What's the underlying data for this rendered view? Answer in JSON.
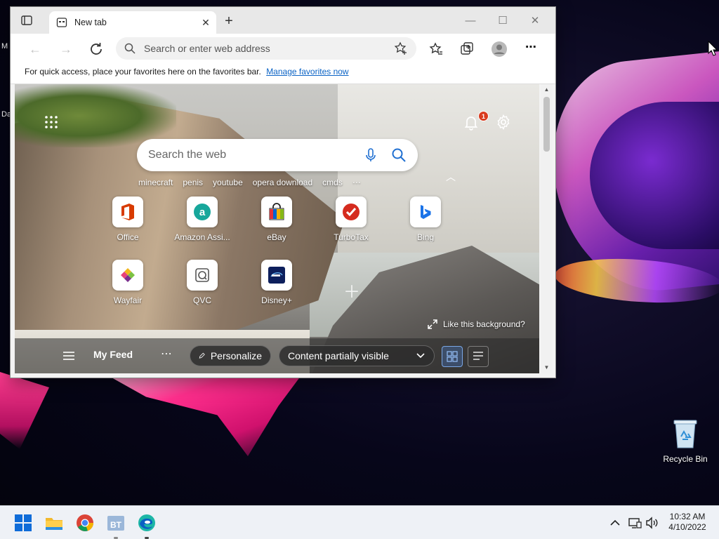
{
  "desktop": {
    "left_letters": [
      "M",
      "Da"
    ],
    "recycle_bin_label": "Recycle Bin"
  },
  "browser": {
    "tab_title": "New tab",
    "address_placeholder": "Search or enter web address",
    "favorites_bar": {
      "message": "For quick access, place your favorites here on the favorites bar.",
      "link": "Manage favorites now"
    },
    "ntp": {
      "search_placeholder": "Search the web",
      "notification_count": "1",
      "trending": [
        "minecraft",
        "penis",
        "youtube",
        "opera download",
        "cmds",
        "⋯"
      ],
      "tiles": [
        {
          "name": "Office",
          "icon": "office-icon"
        },
        {
          "name": "Amazon Assi...",
          "icon": "amazon-assistant-icon"
        },
        {
          "name": "eBay",
          "icon": "ebay-icon"
        },
        {
          "name": "TurboTax",
          "icon": "turbotax-icon"
        },
        {
          "name": "Bing",
          "icon": "bing-icon"
        },
        {
          "name": "Wayfair",
          "icon": "wayfair-icon"
        },
        {
          "name": "QVC",
          "icon": "qvc-icon"
        },
        {
          "name": "Disney+",
          "icon": "disney-plus-icon"
        }
      ],
      "like_background": "Like this background?",
      "feed": {
        "title": "My Feed",
        "more": "⋯",
        "personalize": "Personalize",
        "content_visibility": "Content partially visible"
      }
    }
  },
  "taskbar": {
    "apps": [
      "start-icon",
      "file-explorer-icon",
      "chrome-icon",
      "bt-app-icon",
      "edge-icon"
    ],
    "time": "10:32 AM",
    "date": "4/10/2022"
  },
  "colors": {
    "accent": "#0b63c5",
    "badge": "#d93b1f",
    "taskbar_bg": "#eef1f6"
  }
}
